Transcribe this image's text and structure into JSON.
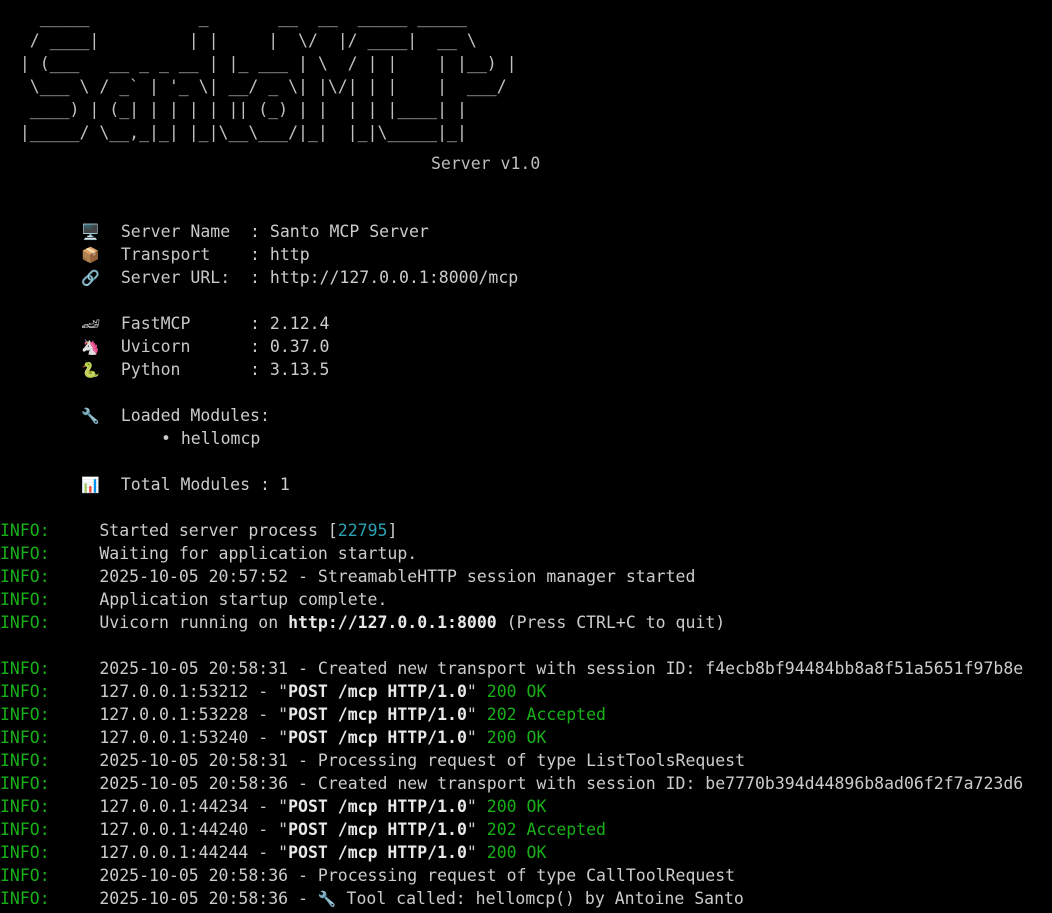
{
  "banner": {
    "art": [
      "    _____           _       __  __  _____ _____  ",
      "   / ____|         | |     |  \\/  |/ ____|  __ \\ ",
      "  | (___   __ _ _ __ | |_ ___ | \\  / | |    | |__) |",
      "   \\___ \\ / _` | '_ \\| __/ _ \\| |\\/| | |    |  ___/ ",
      "   ____) | (_| | | | | || (_) | |  | | |____| |     ",
      "  |_____/ \\__,_|_| |_|\\__\\___/|_|  |_|\\_____|_|     "
    ],
    "version": "Server v1.0"
  },
  "info": [
    {
      "icon": "🖥️",
      "icon_name": "monitor-icon",
      "label": "Server Name  ",
      "value": "Santo MCP Server"
    },
    {
      "icon": "📦",
      "icon_name": "package-icon",
      "label": "Transport    ",
      "value": "http"
    },
    {
      "icon": "🔗",
      "icon_name": "link-icon",
      "label": "Server URL:  ",
      "value": "http://127.0.0.1:8000/mcp"
    }
  ],
  "versions": [
    {
      "icon": "🏎",
      "icon_name": "race-car-icon",
      "label": "FastMCP      ",
      "value": "2.12.4"
    },
    {
      "icon": "🦄",
      "icon_name": "unicorn-icon",
      "label": "Uvicorn      ",
      "value": "0.37.0"
    },
    {
      "icon": "🐍",
      "icon_name": "snake-icon",
      "label": "Python       ",
      "value": "3.13.5"
    }
  ],
  "modules": {
    "icon": "🔧",
    "icon_name": "wrench-icon",
    "heading": "Loaded Modules:",
    "bullet": "•",
    "items": [
      "hellomcp"
    ],
    "total_icon": "📊",
    "total_icon_name": "bar-chart-icon",
    "total_label": "Total Modules",
    "total_value": "1"
  },
  "log": {
    "level": "INFO:",
    "startup": {
      "started_prefix": "Started server process [",
      "pid": "22795",
      "started_suffix": "]",
      "waiting": "Waiting for application startup.",
      "session_manager": "2025-10-05 20:57:52 - StreamableHTTP session manager started",
      "complete": "Application startup complete.",
      "running_prefix": "Uvicorn running on ",
      "running_url": "http://127.0.0.1:8000",
      "running_suffix": " (Press CTRL+C to quit)"
    },
    "requests": [
      {
        "kind": "plain",
        "text": "2025-10-05 20:58:31 - Created new transport with session ID: f4ecb8bf94484bb8a8f51a5651f97b8e"
      },
      {
        "kind": "http",
        "addr": "127.0.0.1:53212",
        "request": "POST /mcp HTTP/1.0",
        "status": "200 OK"
      },
      {
        "kind": "http",
        "addr": "127.0.0.1:53228",
        "request": "POST /mcp HTTP/1.0",
        "status": "202 Accepted"
      },
      {
        "kind": "http",
        "addr": "127.0.0.1:53240",
        "request": "POST /mcp HTTP/1.0",
        "status": "200 OK"
      },
      {
        "kind": "plain",
        "text": "2025-10-05 20:58:31 - Processing request of type ListToolsRequest"
      },
      {
        "kind": "plain",
        "text": "2025-10-05 20:58:36 - Created new transport with session ID: be7770b394d44896b8ad06f2f7a723d6"
      },
      {
        "kind": "http",
        "addr": "127.0.0.1:44234",
        "request": "POST /mcp HTTP/1.0",
        "status": "200 OK"
      },
      {
        "kind": "http",
        "addr": "127.0.0.1:44240",
        "request": "POST /mcp HTTP/1.0",
        "status": "202 Accepted"
      },
      {
        "kind": "http",
        "addr": "127.0.0.1:44244",
        "request": "POST /mcp HTTP/1.0",
        "status": "200 OK"
      },
      {
        "kind": "plain",
        "text": "2025-10-05 20:58:36 - Processing request of type CallToolRequest"
      },
      {
        "kind": "tool",
        "prefix": "2025-10-05 20:58:36 - ",
        "icon": "🔧",
        "icon_name": "wrench-icon",
        "text": " Tool called: hellomcp() by Antoine Santo"
      }
    ]
  },
  "colors": {
    "background": "#000000",
    "text": "#cccccc",
    "level": "#18b018",
    "status": "#18b018",
    "pid": "#2aa1b3"
  }
}
